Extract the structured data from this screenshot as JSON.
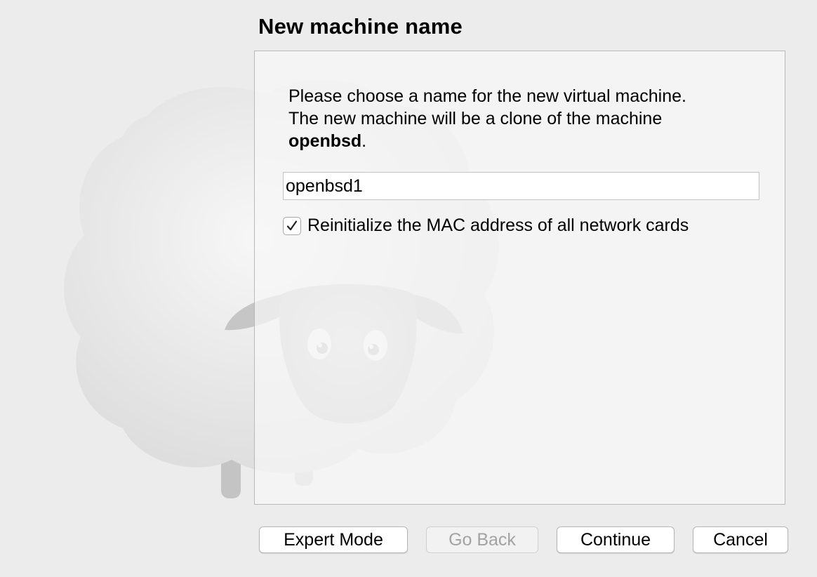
{
  "page": {
    "title": "New machine name"
  },
  "description": {
    "line1": "Please choose a name for the new virtual machine.",
    "line2": "The new machine will be a clone of the machine",
    "machine_name": "openbsd",
    "suffix": "."
  },
  "name_field": {
    "value": "openbsd1"
  },
  "mac_option": {
    "label": "Reinitialize the MAC address of all network cards",
    "checked": true
  },
  "buttons": {
    "expert_mode": "Expert Mode",
    "go_back": "Go Back",
    "continue": "Continue",
    "cancel": "Cancel"
  },
  "icons": {
    "background": "sheep-illustration",
    "checkmark": "checkmark-icon"
  }
}
